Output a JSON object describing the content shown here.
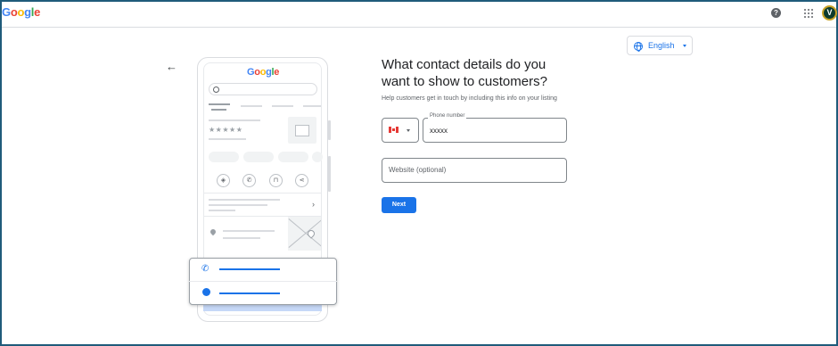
{
  "header": {
    "logo": "Google",
    "help_icon": "help-circle-icon",
    "help_glyph": "?",
    "apps_icon": "apps-grid-icon",
    "avatar_initial": "V",
    "avatar_color": "#0d3b2e"
  },
  "language_selector": {
    "icon": "globe-icon",
    "selected": "English"
  },
  "back_button": {
    "icon": "arrow-back-icon",
    "glyph": "←"
  },
  "illustration": {
    "logo": "Google",
    "stars": "★★★★★",
    "chevron": "›",
    "icons": [
      "directions-icon",
      "phone-icon",
      "bookmark-icon",
      "share-icon"
    ],
    "icon_glyphs": [
      "◈",
      "✆",
      "⊓",
      "⋖"
    ],
    "highlight_rows": [
      "phone-icon",
      "globe-icon"
    ],
    "highlight_phone_glyph": "✆"
  },
  "form": {
    "title": "What contact details do you want to show to customers?",
    "subtitle": "Help customers get in touch by including this info on your listing",
    "country_flag": "canada-flag-icon",
    "phone_label": "Phone number",
    "phone_value": "xxxxx",
    "website_placeholder": "Website (optional)",
    "next_label": "Next"
  },
  "colors": {
    "accent": "#1a73e8",
    "border": "#dadce0",
    "frame": "#1f5b7a"
  }
}
